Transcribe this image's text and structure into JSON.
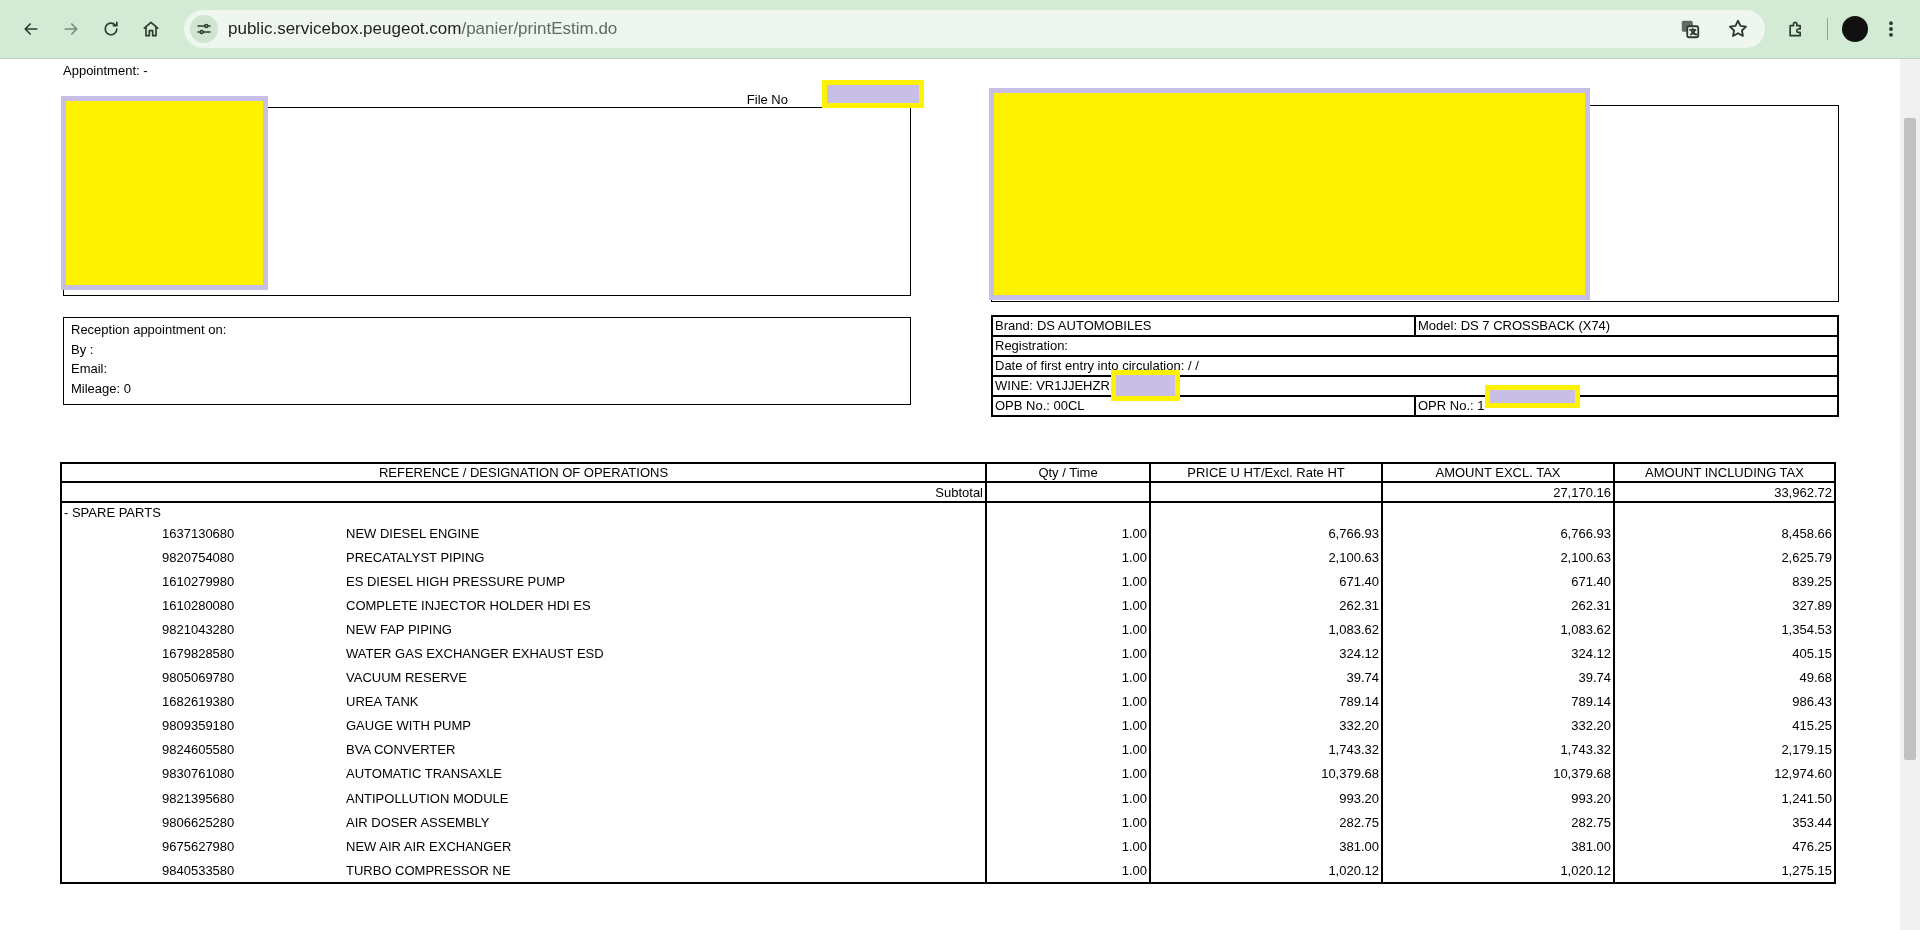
{
  "browser": {
    "url_host": "public.servicebox.peugeot.com",
    "url_path": "/panier/printEstim.do"
  },
  "header": {
    "appointment": "Appointment: -",
    "file_no_label": "File No"
  },
  "reception": {
    "lines": [
      "Reception appointment on:",
      "By :",
      "Email:",
      "Mileage: 0"
    ]
  },
  "vehicle": {
    "rows": [
      [
        {
          "text": "Brand: DS AUTOMOBILES"
        },
        {
          "text": "Model: DS 7 CROSSBACK (X74)"
        }
      ],
      [
        {
          "text": "Registration:",
          "colspan": 2
        }
      ],
      [
        {
          "text": "Date of first entry into circulation: / /",
          "colspan": 2
        }
      ],
      [
        {
          "text": "WINE: VR1JJEHZR",
          "colspan": 2
        }
      ],
      [
        {
          "text": "OPB No.: 00CL"
        },
        {
          "text": "OPR No.: 1"
        }
      ]
    ]
  },
  "table": {
    "columns": [
      "REFERENCE / DESIGNATION OF OPERATIONS",
      "Qty / Time",
      "PRICE U HT/Excl. Rate HT",
      "AMOUNT EXCL. TAX",
      "AMOUNT INCLUDING TAX"
    ],
    "subtotal": {
      "label": "Subtotal",
      "amount_excl_tax": "27,170.16",
      "amount_incl_tax": "33,962.72"
    },
    "section": "- SPARE PARTS",
    "rows": [
      {
        "ref": "1637130680",
        "designation": "NEW DIESEL ENGINE",
        "qty": "1.00",
        "unit_price": "6,766.93",
        "amount_excl_tax": "6,766.93",
        "amount_incl_tax": "8,458.66"
      },
      {
        "ref": "9820754080",
        "designation": "PRECATALYST PIPING",
        "qty": "1.00",
        "unit_price": "2,100.63",
        "amount_excl_tax": "2,100.63",
        "amount_incl_tax": "2,625.79"
      },
      {
        "ref": "1610279980",
        "designation": "ES DIESEL HIGH PRESSURE PUMP",
        "qty": "1.00",
        "unit_price": "671.40",
        "amount_excl_tax": "671.40",
        "amount_incl_tax": "839.25"
      },
      {
        "ref": "1610280080",
        "designation": "COMPLETE INJECTOR HOLDER HDI ES",
        "qty": "1.00",
        "unit_price": "262.31",
        "amount_excl_tax": "262.31",
        "amount_incl_tax": "327.89"
      },
      {
        "ref": "9821043280",
        "designation": "NEW FAP PIPING",
        "qty": "1.00",
        "unit_price": "1,083.62",
        "amount_excl_tax": "1,083.62",
        "amount_incl_tax": "1,354.53"
      },
      {
        "ref": "1679828580",
        "designation": "WATER GAS EXCHANGER EXHAUST ESD",
        "qty": "1.00",
        "unit_price": "324.12",
        "amount_excl_tax": "324.12",
        "amount_incl_tax": "405.15"
      },
      {
        "ref": "9805069780",
        "designation": "VACUUM RESERVE",
        "qty": "1.00",
        "unit_price": "39.74",
        "amount_excl_tax": "39.74",
        "amount_incl_tax": "49.68"
      },
      {
        "ref": "1682619380",
        "designation": "UREA TANK",
        "qty": "1.00",
        "unit_price": "789.14",
        "amount_excl_tax": "789.14",
        "amount_incl_tax": "986.43"
      },
      {
        "ref": "9809359180",
        "designation": "GAUGE WITH PUMP",
        "qty": "1.00",
        "unit_price": "332.20",
        "amount_excl_tax": "332.20",
        "amount_incl_tax": "415.25"
      },
      {
        "ref": "9824605580",
        "designation": "BVA CONVERTER",
        "qty": "1.00",
        "unit_price": "1,743.32",
        "amount_excl_tax": "1,743.32",
        "amount_incl_tax": "2,179.15"
      },
      {
        "ref": "9830761080",
        "designation": "AUTOMATIC TRANSAXLE",
        "qty": "1.00",
        "unit_price": "10,379.68",
        "amount_excl_tax": "10,379.68",
        "amount_incl_tax": "12,974.60"
      },
      {
        "ref": "9821395680",
        "designation": "ANTIPOLLUTION MODULE",
        "qty": "1.00",
        "unit_price": "993.20",
        "amount_excl_tax": "993.20",
        "amount_incl_tax": "1,241.50"
      },
      {
        "ref": "9806625280",
        "designation": "AIR DOSER ASSEMBLY",
        "qty": "1.00",
        "unit_price": "282.75",
        "amount_excl_tax": "282.75",
        "amount_incl_tax": "353.44"
      },
      {
        "ref": "9675627980",
        "designation": "NEW AIR AIR EXCHANGER",
        "qty": "1.00",
        "unit_price": "381.00",
        "amount_excl_tax": "381.00",
        "amount_incl_tax": "476.25"
      },
      {
        "ref": "9840533580",
        "designation": "TURBO COMPRESSOR NE",
        "qty": "1.00",
        "unit_price": "1,020.12",
        "amount_excl_tax": "1,020.12",
        "amount_incl_tax": "1,275.15"
      }
    ]
  }
}
